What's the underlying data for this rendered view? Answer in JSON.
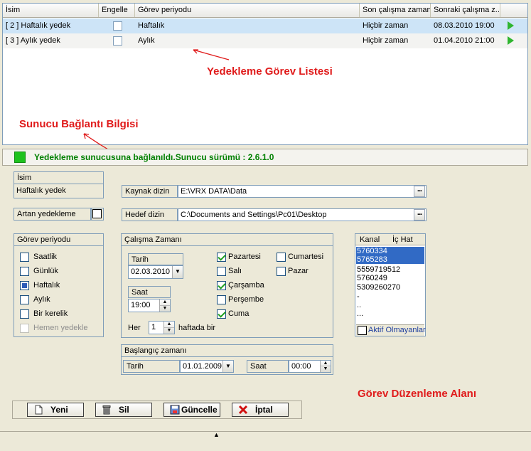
{
  "grid": {
    "headers": [
      "İsim",
      "Engelle",
      "Görev periyodu",
      "Son çalışma zamanı",
      "Sonraki çalışma z..."
    ],
    "rows": [
      {
        "name": "[ 2 ] Haftalık yedek",
        "period": "Haftalık",
        "last_run": "Hiçbir zaman",
        "next_run": "08.03.2010 19:00"
      },
      {
        "name": "[ 3 ] Aylık yedek",
        "period": "Aylık",
        "last_run": "Hiçbir zaman",
        "next_run": "01.04.2010 21:00"
      }
    ]
  },
  "annotations": {
    "task_list": "Yedekleme Görev Listesi",
    "server_info": "Sunucu Bağlantı Bilgisi",
    "edit_area": "Görev Düzenleme Alanı"
  },
  "status": {
    "text": "Yedekleme sunucusuna bağlanıldı.Sunucu sürümü : 2.6.1.0",
    "color": "#1ec21e"
  },
  "form": {
    "name_label": "İsim",
    "name_value": "Haftalık yedek",
    "incremental_label": "Artan yedekleme",
    "period_label": "Görev periyodu",
    "period_options": [
      "Saatlik",
      "Günlük",
      "Haftalık",
      "Aylık",
      "Bir kerelik",
      "Hemen yedekle"
    ],
    "period_selected": "Haftalık",
    "source_label": "Kaynak dizin",
    "source_value": "E:\\VRX DATA\\Data",
    "target_label": "Hedef dizin",
    "target_value": "C:\\Documents and Settings\\Pc01\\Desktop",
    "schedule_label": "Çalışma Zamanı",
    "date_label": "Tarih",
    "date_value": "02.03.2010",
    "time_label": "Saat",
    "time_value": "19:00",
    "every_label": "Her",
    "every_value": "1",
    "weeks_label": "haftada bir",
    "days": [
      {
        "label": "Pazartesi",
        "checked": true
      },
      {
        "label": "Salı",
        "checked": false
      },
      {
        "label": "Çarşamba",
        "checked": true
      },
      {
        "label": "Perşembe",
        "checked": false
      },
      {
        "label": "Cuma",
        "checked": true
      },
      {
        "label": "Cumartesi",
        "checked": false
      },
      {
        "label": "Pazar",
        "checked": false
      }
    ],
    "start_label": "Başlangıç zamanı",
    "start_date_label": "Tarih",
    "start_date_value": "01.01.2009",
    "start_time_label": "Saat",
    "start_time_value": "00:00"
  },
  "channels": {
    "col1": "Kanal",
    "col2": "İç Hat",
    "items": [
      "5760334",
      "5765283",
      "5559719512",
      "5760249",
      "5309260270",
      "-",
      "..",
      "..."
    ],
    "selected": [
      "5760334",
      "5765283"
    ],
    "inactive_label": "Aktif Olmayanlar"
  },
  "buttons": {
    "new": "Yeni",
    "delete": "Sil",
    "update": "Güncelle",
    "cancel": "İptal"
  },
  "icons": {
    "run": "play-icon",
    "new": "new-document-icon",
    "delete": "trash-icon",
    "update": "save-icon",
    "cancel": "cross-icon"
  }
}
